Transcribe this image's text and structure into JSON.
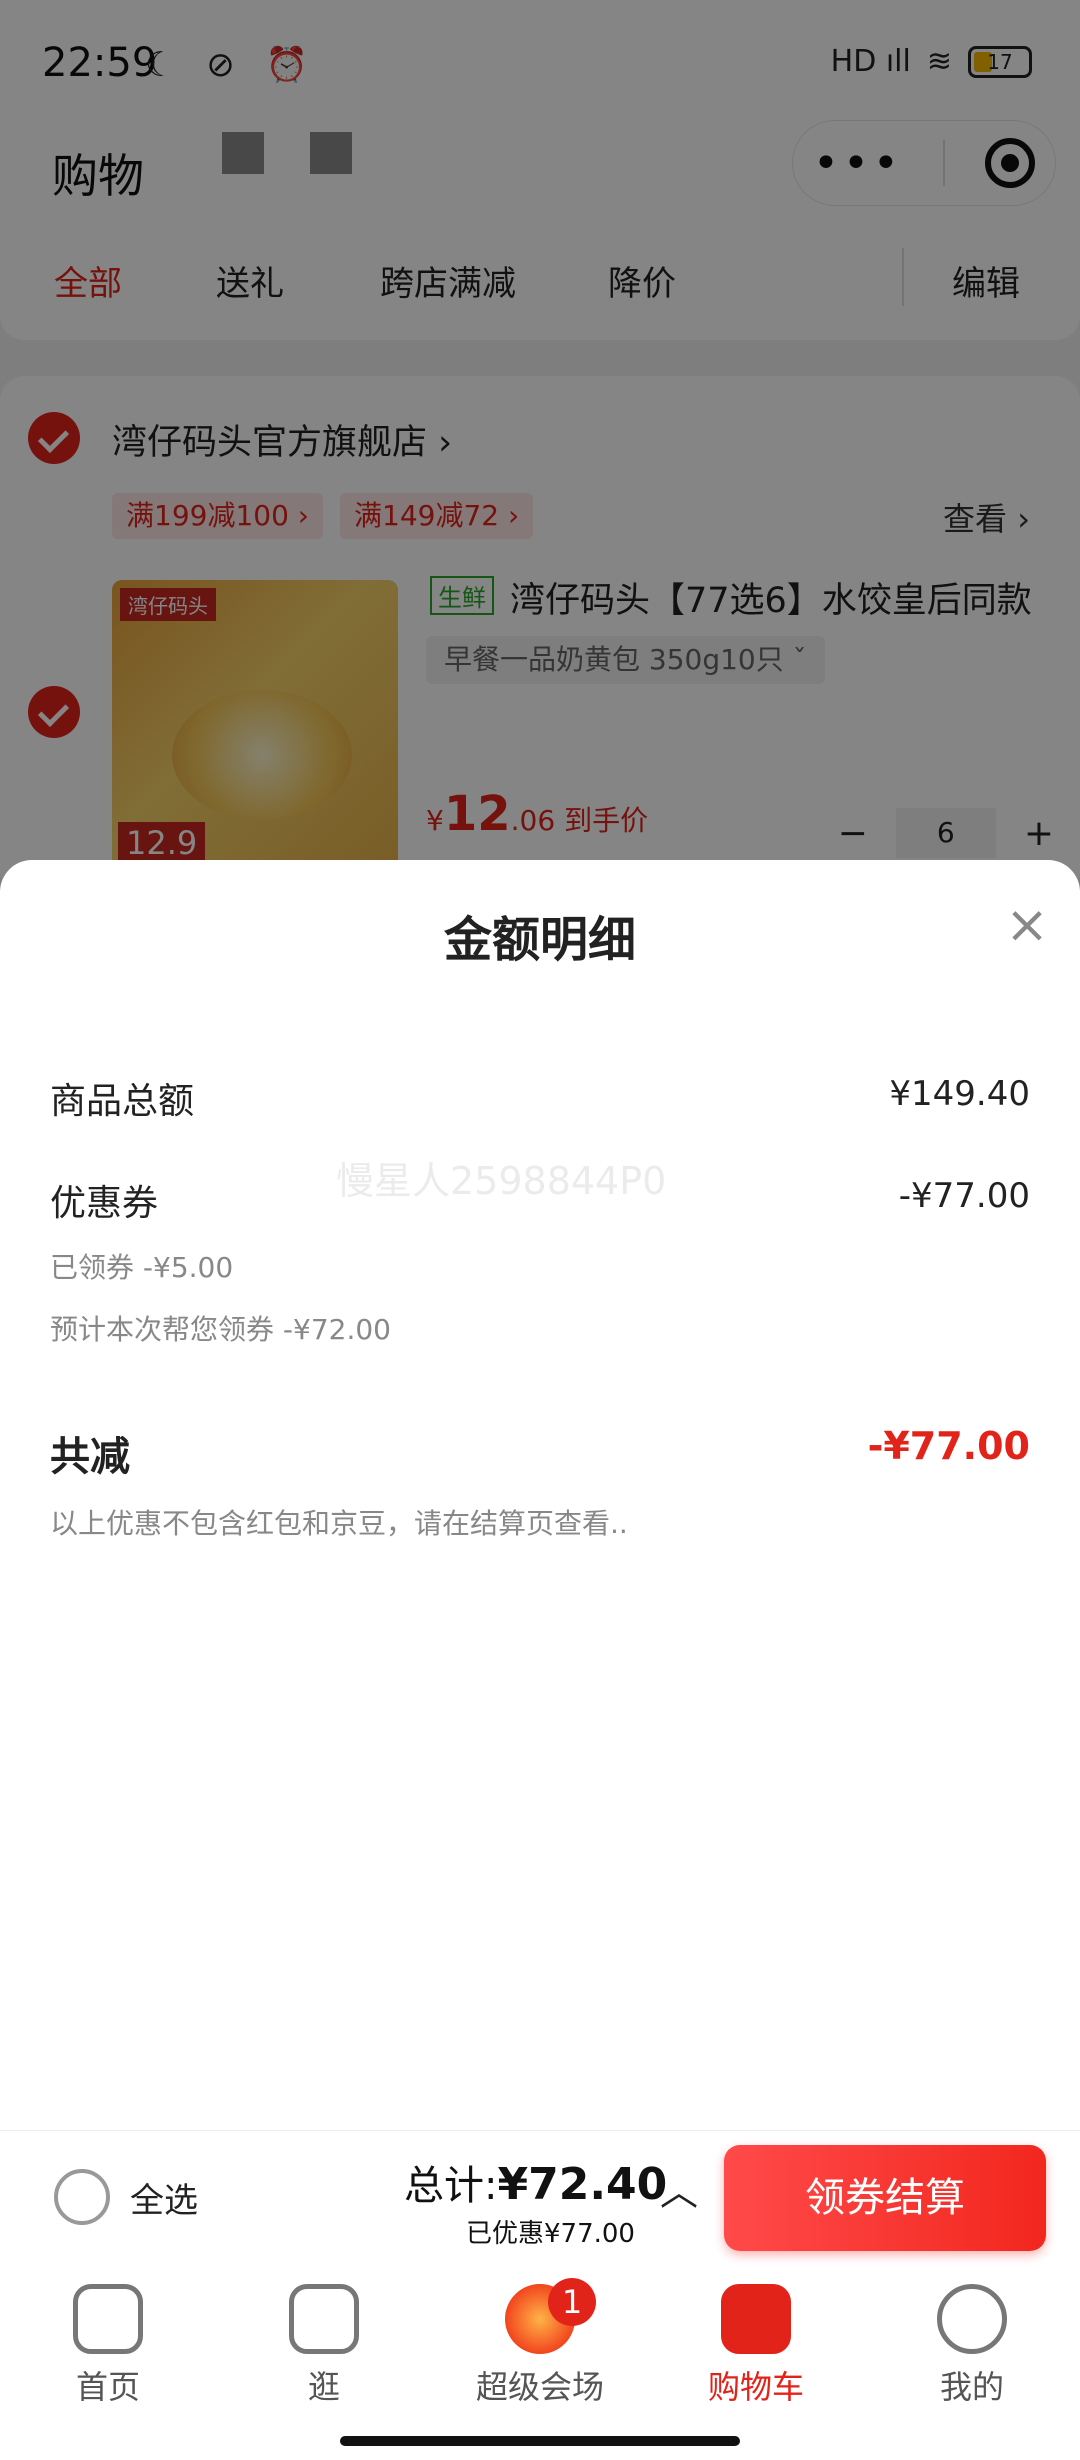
{
  "status": {
    "time": "22:59",
    "icons": "☾ ⊘ ⏰",
    "signal": "HD ıll",
    "wifi": "≋",
    "battery": "17"
  },
  "header": {
    "title": "购物",
    "capsule_menu": "•••"
  },
  "tabs": [
    "全部",
    "送礼",
    "跨店满减",
    "降价",
    "编辑"
  ],
  "store": {
    "name": "湾仔码头官方旗舰店 ›",
    "promos": [
      "满199减100 ›",
      "满149减72 ›"
    ],
    "see_more": "查看 ›",
    "product": {
      "tag": "生鲜",
      "name": "湾仔码头【77选6】水饺皇后同款",
      "spec": "早餐一品奶黄包 350g10只  ˇ",
      "price_symbol": "¥",
      "price_main": "12",
      "price_decimal": ".06",
      "price_note": "到手价",
      "qty": "6",
      "minus": "−",
      "plus": "+",
      "image_badge": "湾仔码头",
      "image_price": "12.9"
    }
  },
  "modal": {
    "title": "金额明细",
    "close": "×",
    "goods_total_label": "商品总额",
    "goods_total_value": "¥149.40",
    "coupon_label": "优惠券",
    "coupon_value": "-¥77.00",
    "coupon_claimed": "已领券 -¥5.00",
    "coupon_estimated": "预计本次帮您领券 -¥72.00",
    "total_reduce_label": "共减",
    "total_reduce_value": "-¥77.00",
    "note": "以上优惠不包含红包和京豆，请在结算页查看..",
    "watermark": "慢星人2598844P0"
  },
  "bottom": {
    "select_all": "全选",
    "total_prefix": "总计:",
    "total_value": "¥72.40",
    "saved": "已优惠¥77.00",
    "chevron": "︿",
    "checkout": "领券结算"
  },
  "tabbar": [
    {
      "label": "首页",
      "icon": "home-icon"
    },
    {
      "label": "逛",
      "icon": "play-icon"
    },
    {
      "label": "超级会场",
      "icon": "fire-icon",
      "badge": "1"
    },
    {
      "label": "购物车",
      "icon": "cart-icon"
    },
    {
      "label": "我的",
      "icon": "profile-icon"
    }
  ],
  "colors": {
    "accent": "#e2231a",
    "checkout_gradient_start": "#ff4a4a",
    "checkout_gradient_end": "#f2271e"
  }
}
